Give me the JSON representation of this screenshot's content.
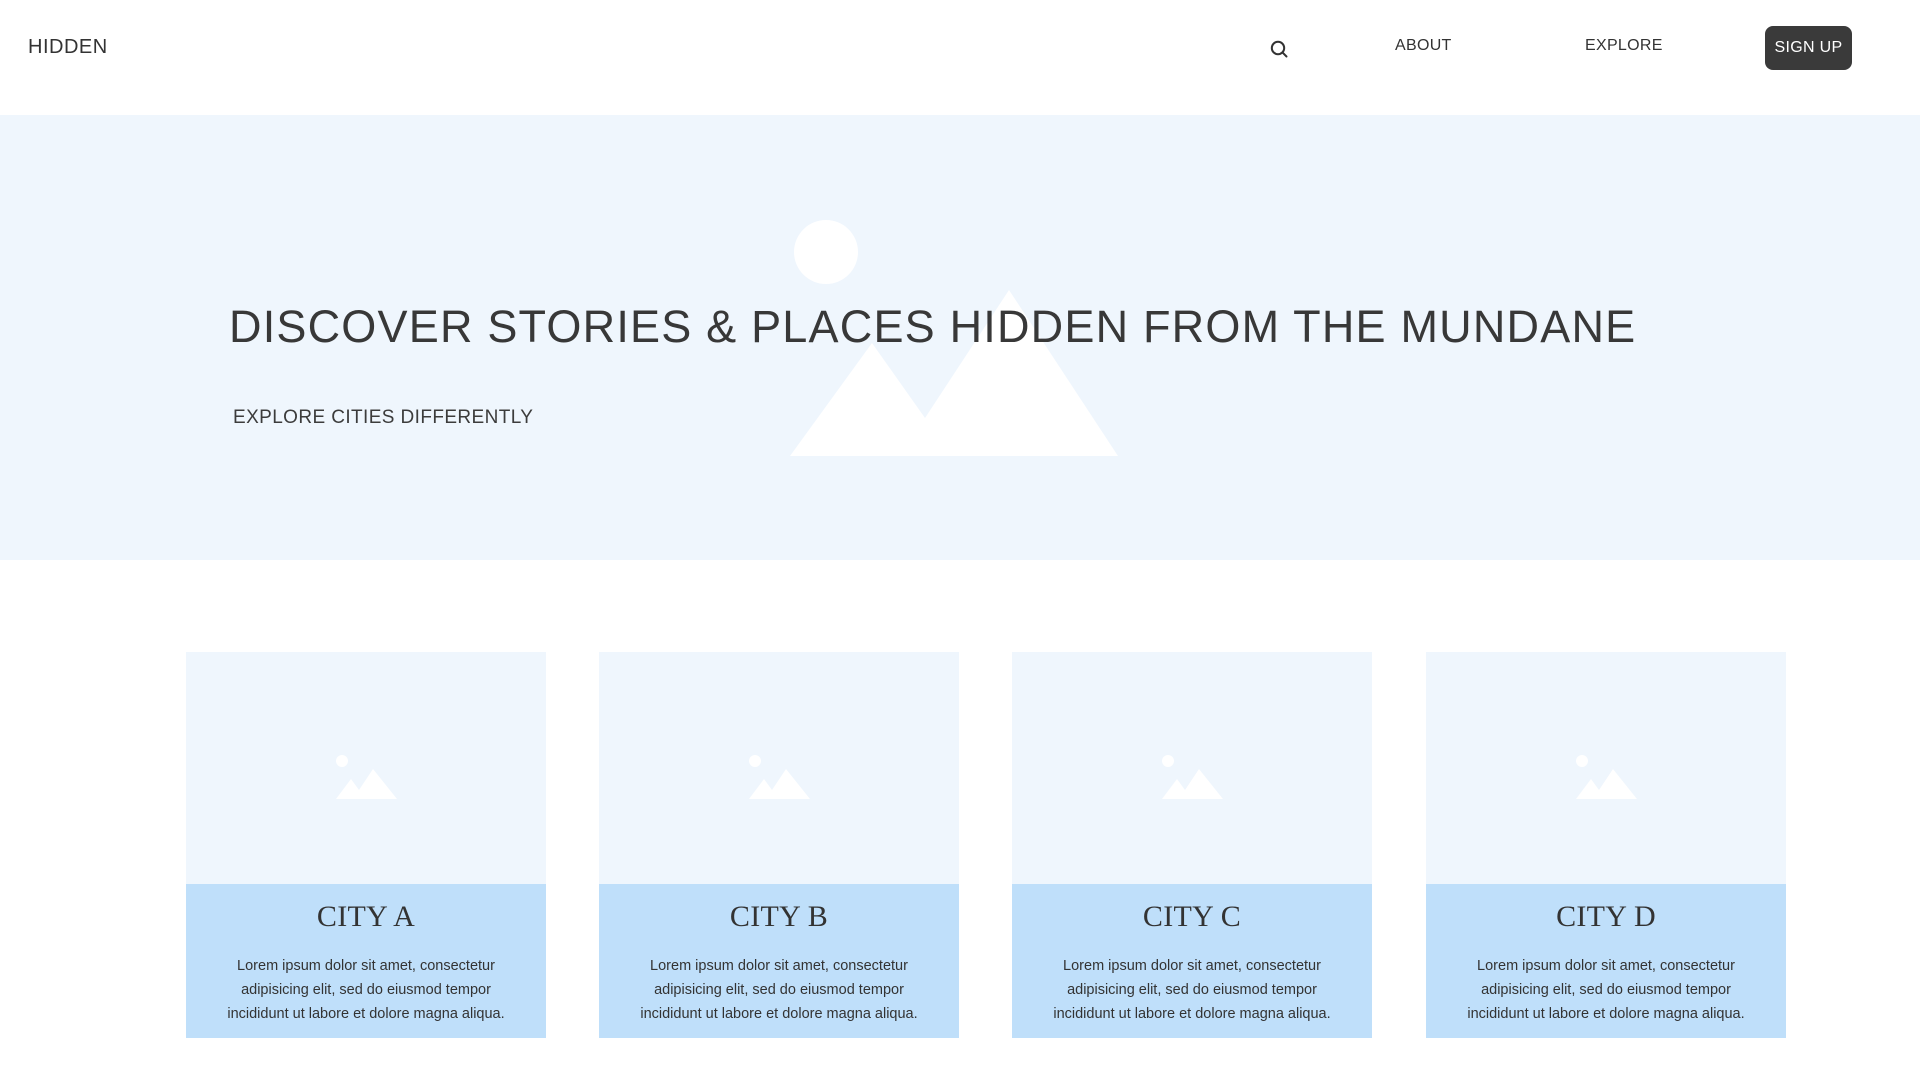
{
  "header": {
    "logo": "HIDDEN",
    "search_icon": "search-icon",
    "nav": [
      {
        "label": "ABOUT"
      },
      {
        "label": "EXPLORE"
      }
    ],
    "signup_label": "SIGN UP"
  },
  "hero": {
    "title": "DISCOVER STORIES & PLACES HIDDEN FROM THE MUNDANE",
    "subtitle": "EXPLORE CITIES DIFFERENTLY",
    "image_icon": "image-placeholder-icon"
  },
  "cards": [
    {
      "title": "CITY A",
      "text": "Lorem ipsum dolor sit amet, consectetur adipisicing elit, sed do eiusmod tempor incididunt ut labore et dolore magna aliqua."
    },
    {
      "title": "CITY B",
      "text": "Lorem ipsum dolor sit amet, consectetur adipisicing elit, sed do eiusmod tempor incididunt ut labore et dolore magna aliqua."
    },
    {
      "title": "CITY C",
      "text": "Lorem ipsum dolor sit amet, consectetur adipisicing elit, sed do eiusmod tempor incididunt ut labore et dolore magna aliqua."
    },
    {
      "title": "CITY D",
      "text": "Lorem ipsum dolor sit amet, consectetur adipisicing elit, sed do eiusmod tempor incididunt ut labore et dolore magna aliqua."
    }
  ],
  "colors": {
    "hero_background": "#eff6fd",
    "card_body": "#bfdffa",
    "button_dark": "#3a3a3a",
    "text_dark": "#383838"
  }
}
